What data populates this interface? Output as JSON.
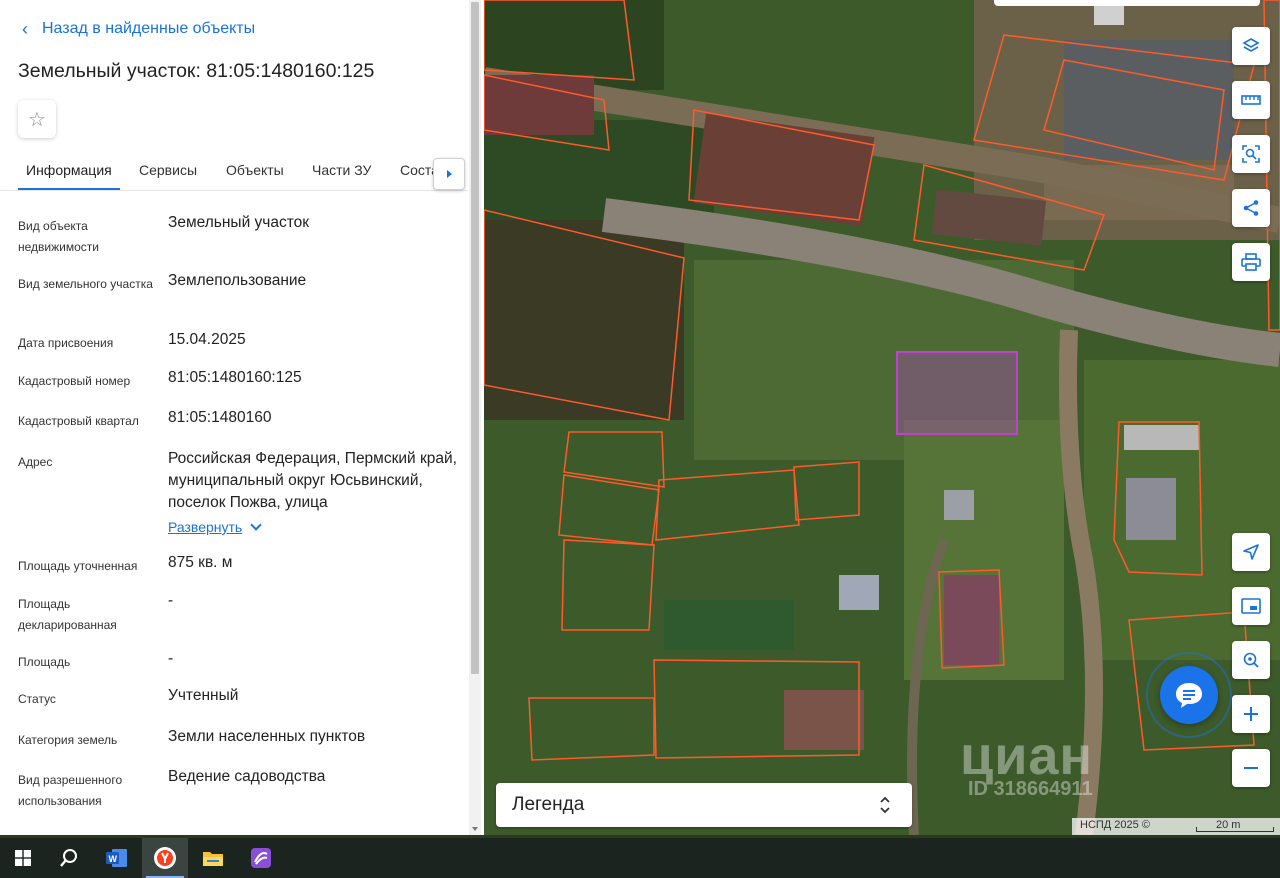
{
  "panel": {
    "back_label": "Назад в найденные объекты",
    "title": "Земельный участок: 81:05:1480160:125",
    "tabs": [
      {
        "label": "Информация",
        "active": true
      },
      {
        "label": "Сервисы"
      },
      {
        "label": "Объекты"
      },
      {
        "label": "Части ЗУ"
      },
      {
        "label": "Соста"
      }
    ],
    "fields": [
      {
        "label": "Вид объекта недвижимости",
        "value": "Земельный участок"
      },
      {
        "label": "Вид земельного участка",
        "value": "Землепользование"
      },
      {
        "label": "Дата присвоения",
        "value": "15.04.2025"
      },
      {
        "label": "Кадастровый номер",
        "value": "81:05:1480160:125"
      },
      {
        "label": "Кадастровый квартал",
        "value": "81:05:1480160"
      },
      {
        "label": "Адрес",
        "value": "Российская Федерация, Пермский край, муниципальный округ Юсьвинский, поселок Пожва, улица"
      },
      {
        "label": "Площадь уточненная",
        "value": "875 кв. м"
      },
      {
        "label": "Площадь декларированная",
        "value": "-"
      },
      {
        "label": "Площадь",
        "value": "-"
      },
      {
        "label": "Статус",
        "value": "Учтенный"
      },
      {
        "label": "Категория земель",
        "value": "Земли населенных пунктов"
      },
      {
        "label": "Вид разрешенного использования",
        "value": "Ведение садоводства"
      }
    ],
    "expand_label": "Развернуть"
  },
  "map": {
    "legend_label": "Легенда",
    "attribution": "НСПД 2025 ©",
    "scale_label": "20 m",
    "watermark": "циан",
    "watermark_id": "ID 318664911",
    "colors": {
      "parcel_border": "#ff5a2a",
      "selected_parcel": "#c040d0",
      "accent": "#1a73d9"
    },
    "buttons": [
      "layers-icon",
      "ruler-icon",
      "select-area-icon",
      "share-icon",
      "print-icon",
      "locate-icon",
      "minimap-icon",
      "geo-search-icon",
      "zoom-in-icon",
      "zoom-out-icon"
    ]
  },
  "taskbar": {
    "items": [
      "windows-start-icon",
      "search-icon",
      "word-icon",
      "yandex-browser-icon",
      "file-explorer-icon",
      "app-icon"
    ]
  }
}
